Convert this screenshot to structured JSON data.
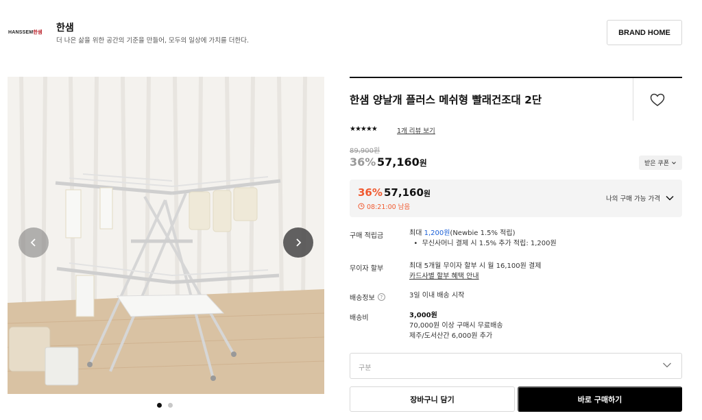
{
  "brand": {
    "logo_text_main": "HANSSEM",
    "logo_text_accent": "한샘",
    "name": "한샘",
    "description": "더 나은 삶을 위한 공간의 기준을 만들어, 모두의 일상에 가치를 더한다.",
    "home_button": "BRAND HOME"
  },
  "gallery": {
    "prev_icon": "chevron-left-icon",
    "next_icon": "chevron-right-icon",
    "dot_count": 2,
    "active_dot": 0,
    "image_description_icon": "drying-rack-photo"
  },
  "product": {
    "title": "한샘 양날개 플러스 메쉬형 빨래건조대 2단",
    "stars": "★★★★★",
    "rating_stars": 5,
    "review_link": "1개 리뷰 보기",
    "original_price": "89,900원",
    "discount_percent": "36%",
    "sale_price_number": "57,160",
    "price_unit": "원",
    "coupon_button": "받은 쿠폰",
    "wishlist_icon": "heart-icon"
  },
  "best_price": {
    "discount_percent": "36%",
    "price_number": "57,160",
    "price_unit": "원",
    "timer": "08:21:00 남음",
    "my_price_label": "나의 구매 가능 가격"
  },
  "info": {
    "points_label": "구매 적립금",
    "points_prefix": "최대 ",
    "points_amount": "1,200원",
    "points_suffix": "(Newbie 1.5% 적립)",
    "points_bullet": "무신사머니 결제 시 1.5% 추가 적립: 1,200원",
    "installment_label": "무이자 할부",
    "installment_value": "최대 5개월 무이자 할부 시 월 16,100원 결제",
    "installment_link": "카드사별 할부 혜택 안내",
    "delivery_label": "배송정보",
    "delivery_help": "?",
    "delivery_value": "3일 이내 배송 시작",
    "shipping_label": "배송비",
    "shipping_fee": "3,000원",
    "shipping_free": "70,000원 이상 구매시 무료배송",
    "shipping_extra": "제주/도서산간 6,000원 추가"
  },
  "option": {
    "placeholder": "구분"
  },
  "actions": {
    "cart_button": "장바구니 담기",
    "buy_button": "바로 구매하기"
  },
  "colors": {
    "accent_orange": "#f0592f",
    "link_blue": "#1a5fd6",
    "brand_red": "#b5121b"
  }
}
